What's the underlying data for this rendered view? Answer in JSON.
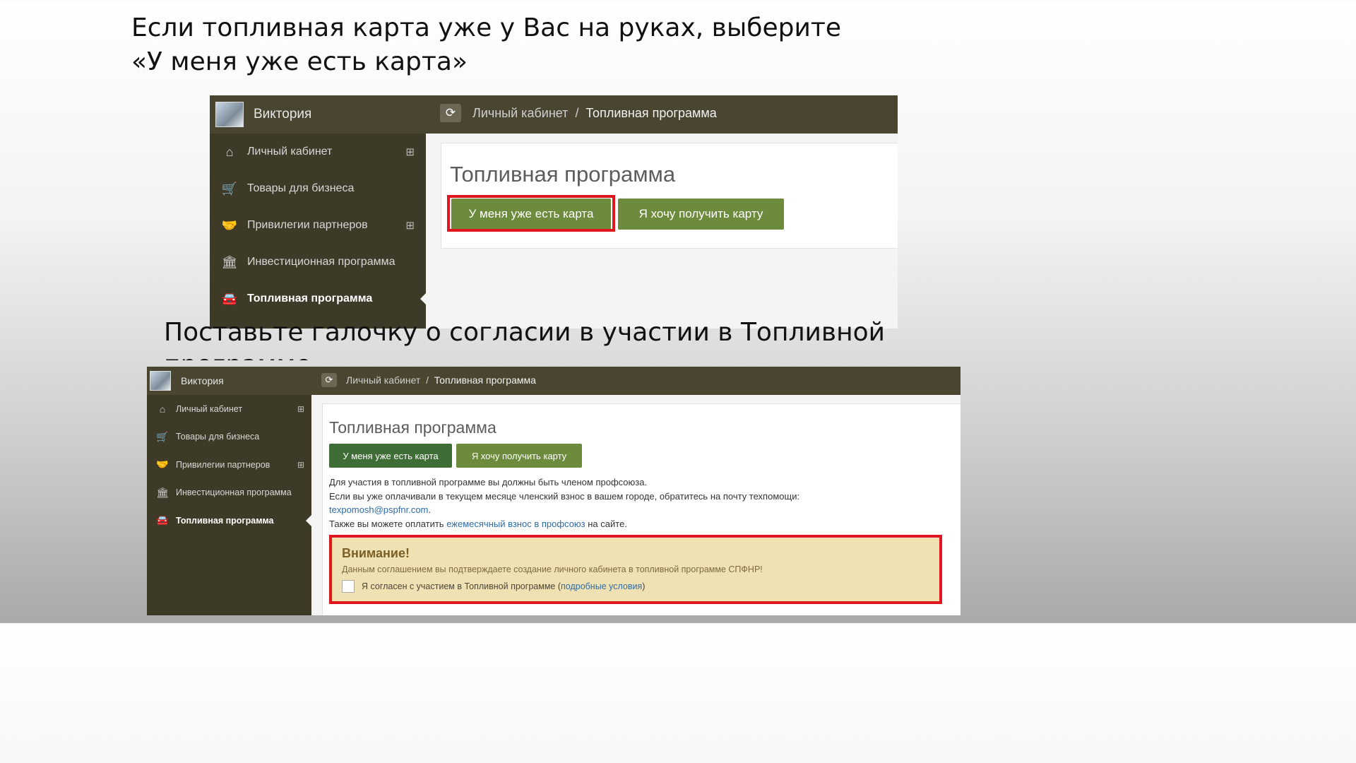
{
  "slide": {
    "heading1_line1": "Если топливная карта уже у Вас на руках, выберите",
    "heading1_line2": "«У меня уже есть карта»",
    "heading2_line1": "Поставьте галочку о согласии в участии в Топливной",
    "heading2_line2": "программе"
  },
  "colors": {
    "topbar": "#4a4530",
    "sidebar": "#3e3a28",
    "button_green": "#6d8b3c",
    "button_dark_green": "#3e6d35",
    "highlight_frame": "#e0161f",
    "alert_bg": "#f0e1b3"
  },
  "app": {
    "user_name": "Виктория",
    "reload_icon": "refresh-icon",
    "breadcrumb": {
      "home": "Личный кабинет",
      "separator": "/",
      "current": "Топливная программа"
    },
    "sidebar": [
      {
        "label": "Личный кабинет",
        "icon": "home-icon",
        "expand": "⊞"
      },
      {
        "label": "Товары для бизнеса",
        "icon": "cart-icon",
        "expand": ""
      },
      {
        "label": "Привилегии партнеров",
        "icon": "handshake-icon",
        "expand": "⊞"
      },
      {
        "label": "Инвестиционная программа",
        "icon": "bank-icon",
        "expand": ""
      },
      {
        "label": "Топливная программа",
        "icon": "car-icon",
        "expand": "",
        "active": true
      }
    ],
    "page_title": "Топливная программа",
    "button_have_card": "У меня уже есть карта",
    "button_get_card": "Я хочу получить карту",
    "info": {
      "line1": "Для участия в топливной программе вы должны быть членом профсоюза.",
      "line2": "Если вы уже оплачивали в текущем месяце членский взнос в вашем городе, обратитесь на почту техпомощи:",
      "email": "texpomosh@pspfnr.com",
      "email_tail": ".",
      "line4_pre": "Также вы можете оплатить ",
      "line4_link": "ежемесячный взнос в профсоюз",
      "line4_post": " на сайте."
    },
    "alert": {
      "title": "Внимание!",
      "message": "Данным соглашением вы подтверждаете создание личного кабинета в топливной программе СПФНР!",
      "agree_pre": "Я согласен с участием в Топливной программе (",
      "agree_link": "подробные условия",
      "agree_post": ")",
      "checked": false
    }
  }
}
